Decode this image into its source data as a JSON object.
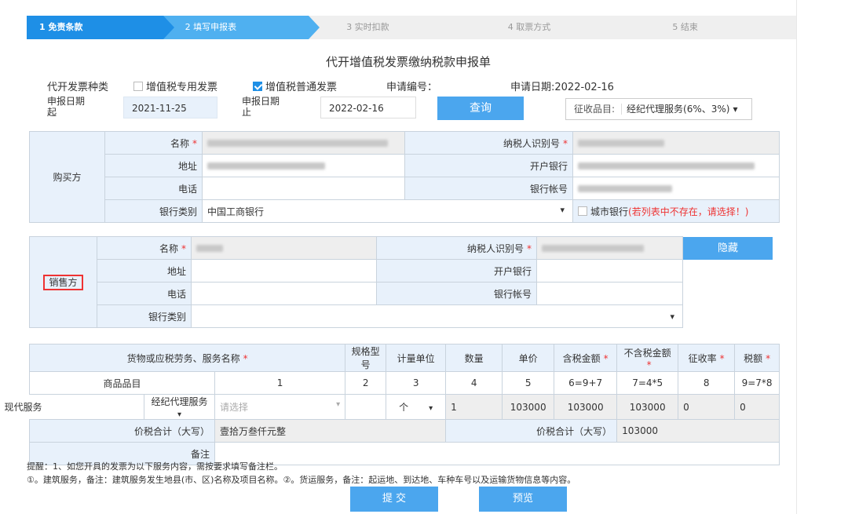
{
  "steps": [
    "1 免责条款",
    "2 填写申报表",
    "3 实时扣款",
    "4 取票方式",
    "5 结束"
  ],
  "title": "代开增值税发票缴纳税款申报单",
  "invoice_type": {
    "label": "代开发票种类",
    "opt1": "增值税专用发票",
    "opt2": "增值税普通发票",
    "apply_no_label": "申请编号：",
    "apply_date": "申请日期:2022-02-16"
  },
  "period": {
    "start_label": "申报日期起",
    "start_value": "2021-11-25",
    "end_label": "申报日期止",
    "end_value": "2022-02-16",
    "query_btn": "查询",
    "levy_label": "征收品目:",
    "levy_value": "经纪代理服务(6%、3%)"
  },
  "buyer": {
    "side": "购买方",
    "name_label": "名称",
    "tin_label": "纳税人识别号",
    "addr_label": "地址",
    "bank_label": "开户银行",
    "phone_label": "电话",
    "account_label": "银行帐号",
    "bank_type_label": "银行类别",
    "bank_type_value": "中国工商银行",
    "city_bank": "城市银行",
    "city_bank_hint": "(若列表中不存在，请选择！)"
  },
  "seller": {
    "side": "销售方",
    "name_label": "名称",
    "tin_label": "纳税人识别号",
    "hide_btn": "隐藏",
    "addr_label": "地址",
    "bank_label": "开户银行",
    "phone_label": "电话",
    "account_label": "银行帐号",
    "bank_type_label": "银行类别"
  },
  "items": {
    "headers": [
      "货物或应税劳务、服务名称",
      "规格型号",
      "计量单位",
      "数量",
      "单价",
      "含税金额",
      "不含税金额",
      "征收率",
      "税额"
    ],
    "index_row": [
      "商品品目",
      "1",
      "2",
      "3",
      "4",
      "5",
      "6=9+7",
      "7=4*5",
      "8",
      "9=7*8"
    ],
    "row": {
      "category": "现代服务",
      "item": "经纪代理服务",
      "select_placeholder": "请选择",
      "unit": "个",
      "qty": "1",
      "price": "103000",
      "tax_incl": "103000",
      "tax_excl": "103000",
      "rate": "0",
      "tax": "0"
    },
    "total_upper_label": "价税合计（大写）",
    "total_upper_value": "壹拾万叁仟元整",
    "total_lower_label": "价税合计（大写）",
    "total_lower_value": "103000",
    "remark_label": "备注"
  },
  "notes": {
    "line1": "提醒：1、如您开具的发票为以下服务内容，需按要求填写备注栏。",
    "line2": "①。建筑服务，备注：建筑服务发生地县(市、区)名称及项目名称。②。货运服务，备注：起运地、到达地、车种车号以及运输货物信息等内容。"
  },
  "buttons": {
    "submit": "提 交",
    "preview": "预览"
  }
}
